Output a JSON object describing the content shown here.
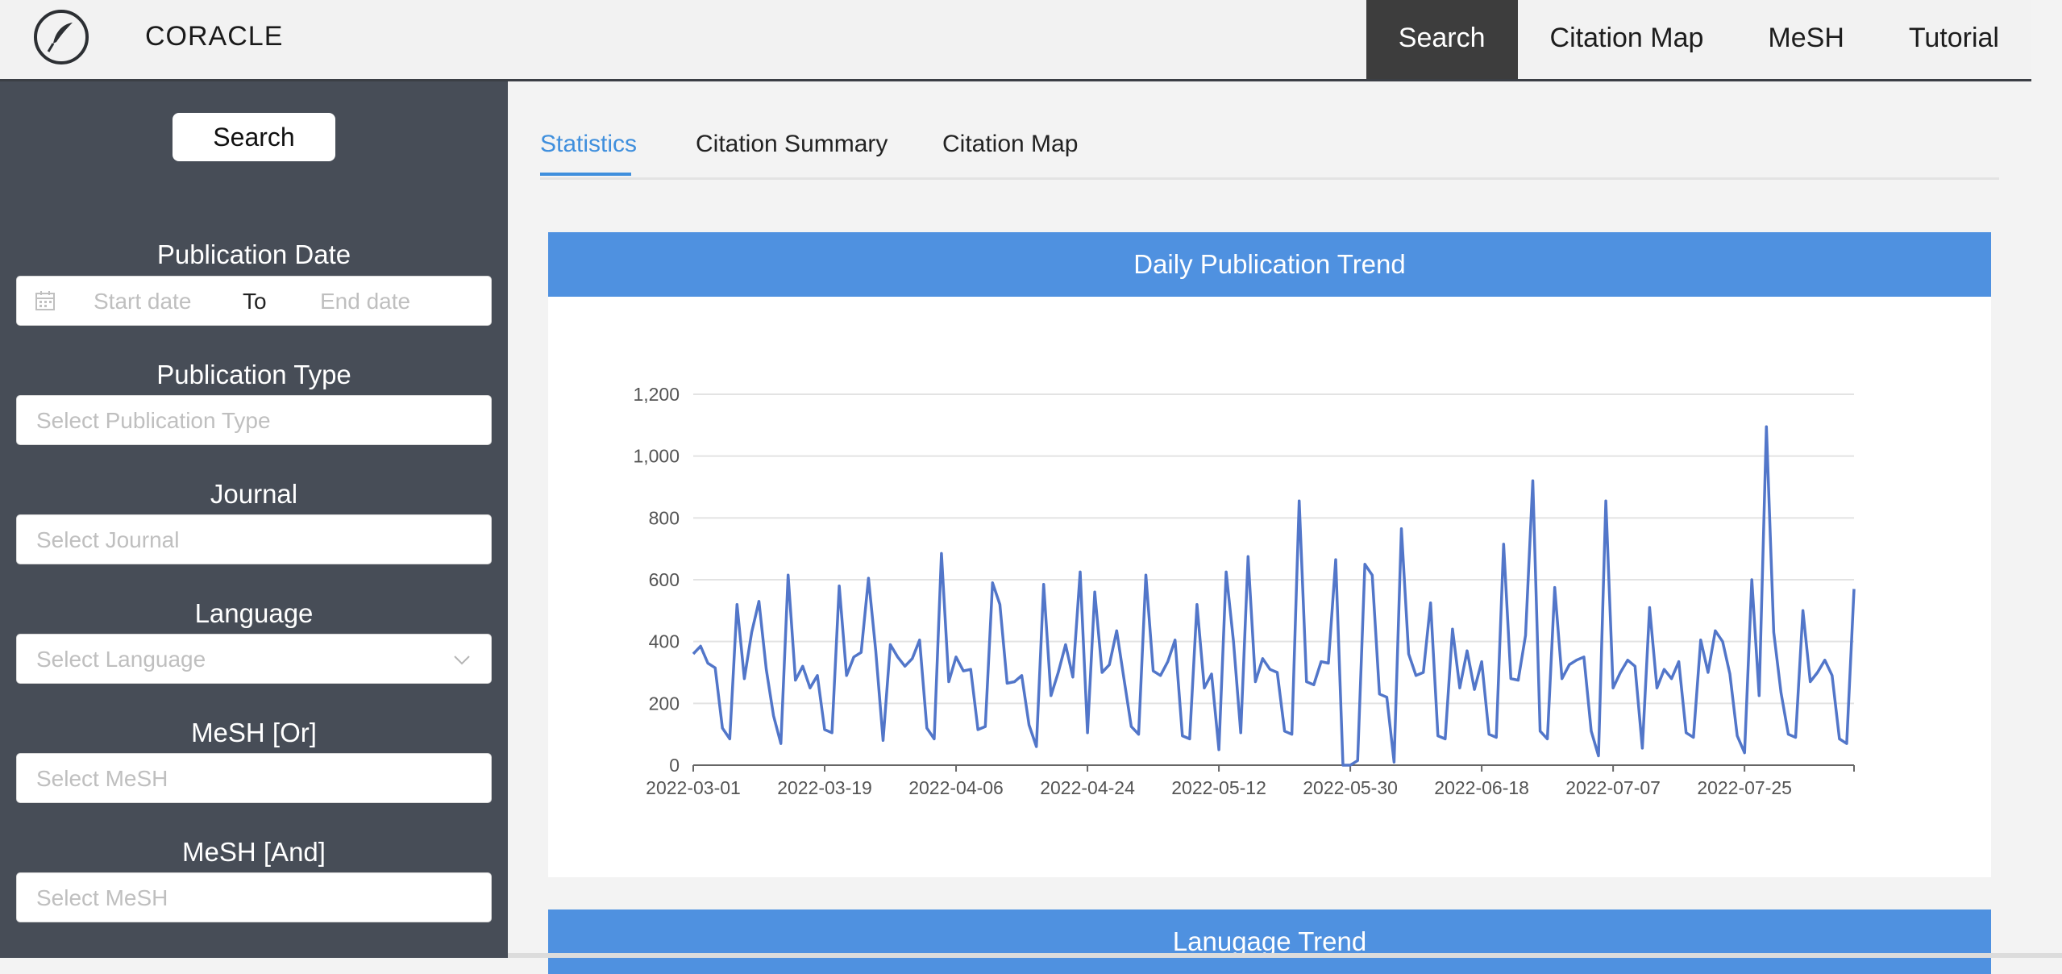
{
  "app": {
    "brand": "CORACLE"
  },
  "nav": [
    "Search",
    "Citation Map",
    "MeSH",
    "Tutorial"
  ],
  "sidebar": {
    "search_button": "Search",
    "publication_date": {
      "label": "Publication Date",
      "start_placeholder": "Start date",
      "separator": "To",
      "end_placeholder": "End date"
    },
    "publication_type": {
      "label": "Publication Type",
      "placeholder": "Select Publication Type"
    },
    "journal": {
      "label": "Journal",
      "placeholder": "Select Journal"
    },
    "language": {
      "label": "Language",
      "placeholder": "Select Language"
    },
    "mesh_or": {
      "label": "MeSH [Or]",
      "placeholder": "Select MeSH"
    },
    "mesh_and": {
      "label": "MeSH [And]",
      "placeholder": "Select MeSH"
    }
  },
  "tabs": [
    "Statistics",
    "Citation Summary",
    "Citation Map"
  ],
  "cards": {
    "daily_title": "Daily Publication Trend",
    "language_title": "Lanugage Trend"
  },
  "colors": {
    "accent": "#4f91e0",
    "line": "#5276c9",
    "sidebar": "#474d57"
  },
  "chart_data": {
    "type": "line",
    "title": "Daily Publication Trend",
    "ylim": [
      0,
      1200
    ],
    "yticks": [
      "0",
      "200",
      "400",
      "600",
      "800",
      "1,000",
      "1,200"
    ],
    "xtick_labels": [
      "2022-03-01",
      "2022-03-19",
      "2022-04-06",
      "2022-04-24",
      "2022-05-12",
      "2022-05-30",
      "2022-06-18",
      "2022-07-07",
      "2022-07-25"
    ],
    "start_date": "2022-03-01",
    "end_date": "2022-08-08",
    "grid": true,
    "series": [
      {
        "values": [
          360,
          385,
          330,
          315,
          120,
          85,
          520,
          280,
          430,
          530,
          310,
          160,
          70,
          615,
          275,
          320,
          250,
          290,
          115,
          105,
          580,
          290,
          350,
          365,
          605,
          370,
          80,
          390,
          350,
          320,
          345,
          405,
          120,
          85,
          685,
          270,
          350,
          305,
          310,
          115,
          125,
          590,
          520,
          265,
          270,
          290,
          130,
          60,
          585,
          225,
          300,
          390,
          285,
          625,
          105,
          560,
          300,
          325,
          435,
          280,
          125,
          100,
          615,
          305,
          290,
          335,
          405,
          95,
          85,
          520,
          250,
          295,
          50,
          625,
          400,
          105,
          675,
          270,
          345,
          310,
          300,
          110,
          100,
          855,
          270,
          260,
          335,
          330,
          665,
          0,
          0,
          15,
          650,
          615,
          230,
          220,
          10,
          765,
          360,
          290,
          300,
          525,
          95,
          85,
          440,
          250,
          370,
          245,
          335,
          100,
          90,
          715,
          280,
          275,
          420,
          920,
          110,
          85,
          575,
          280,
          325,
          340,
          350,
          110,
          30,
          855,
          250,
          300,
          340,
          320,
          55,
          510,
          250,
          310,
          280,
          335,
          105,
          90,
          405,
          300,
          435,
          400,
          295,
          95,
          40,
          600,
          225,
          1095,
          430,
          235,
          100,
          90,
          500,
          270,
          300,
          340,
          290,
          85,
          70,
          570
        ]
      }
    ]
  }
}
